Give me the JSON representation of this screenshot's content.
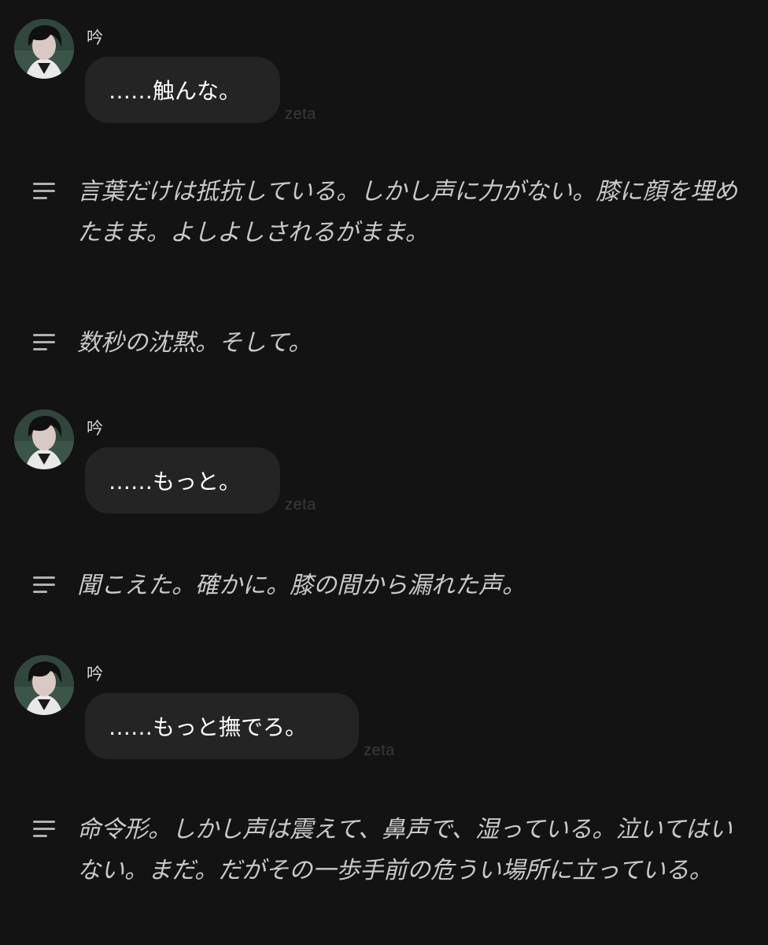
{
  "messages": [
    {
      "speaker": "吟",
      "text": "……触んな。",
      "tag": "zeta"
    },
    {
      "speaker": "吟",
      "text": "……もっと。",
      "tag": "zeta"
    },
    {
      "speaker": "吟",
      "text": "……もっと撫でろ。",
      "tag": "zeta"
    }
  ],
  "narrations": [
    {
      "text": "言葉だけは抵抗している。しかし声に力がない。膝に顔を埋めたまま。よしよしされるがまま。",
      "icon": "narration-icon"
    },
    {
      "text": "数秒の沈黙。そして。",
      "icon": "narration-icon"
    },
    {
      "text": "聞こえた。確かに。膝の間から漏れた声。",
      "icon": "narration-icon"
    },
    {
      "text": "命令形。しかし声は震えて、鼻声で、湿っている。泣いてはいない。まだ。だがその一歩手前の危うい場所に立っている。",
      "icon": "narration-icon"
    }
  ],
  "colors": {
    "background": "#131313",
    "bubble": "#242424",
    "narration_text": "#c9c9c9",
    "tag": "#3a3a3a"
  }
}
